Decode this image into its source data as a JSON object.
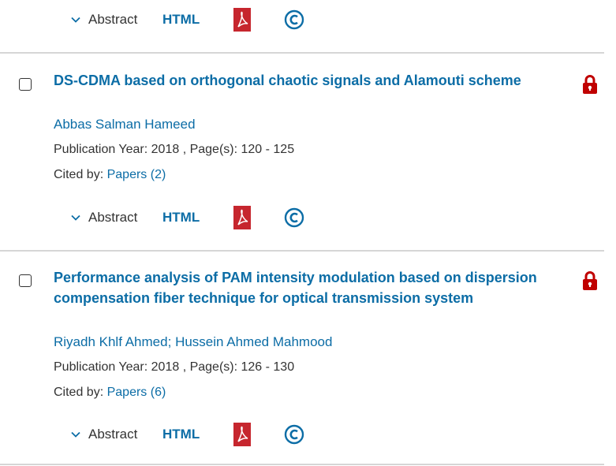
{
  "actions_labels": {
    "abstract": "Abstract",
    "html": "HTML"
  },
  "colors": {
    "link": "#0c6da6",
    "pdf_red": "#c6262e",
    "lock_red": "#c00000",
    "divider": "#d6d6d6"
  },
  "articles": [
    {
      "title": "DS-CDMA based on orthogonal chaotic signals and Alamouti scheme",
      "authors": [
        "Abbas Salman Hameed"
      ],
      "publication_year_label": "Publication Year: 2018 , Page(s): 120  -  125",
      "cited_label": "Cited by: ",
      "cited_link": "Papers (2)",
      "access": "lock-icon"
    },
    {
      "title": "Performance analysis of PAM intensity modulation based on dispersion compensation fiber technique for optical transmission system",
      "authors": [
        "Riyadh Khlf Ahmed",
        "Hussein Ahmed Mahmood"
      ],
      "author_separator": ";",
      "publication_year_label": "Publication Year: 2018 , Page(s): 126  -  130",
      "cited_label": "Cited by: ",
      "cited_link": "Papers (6)",
      "access": "lock-icon"
    }
  ]
}
